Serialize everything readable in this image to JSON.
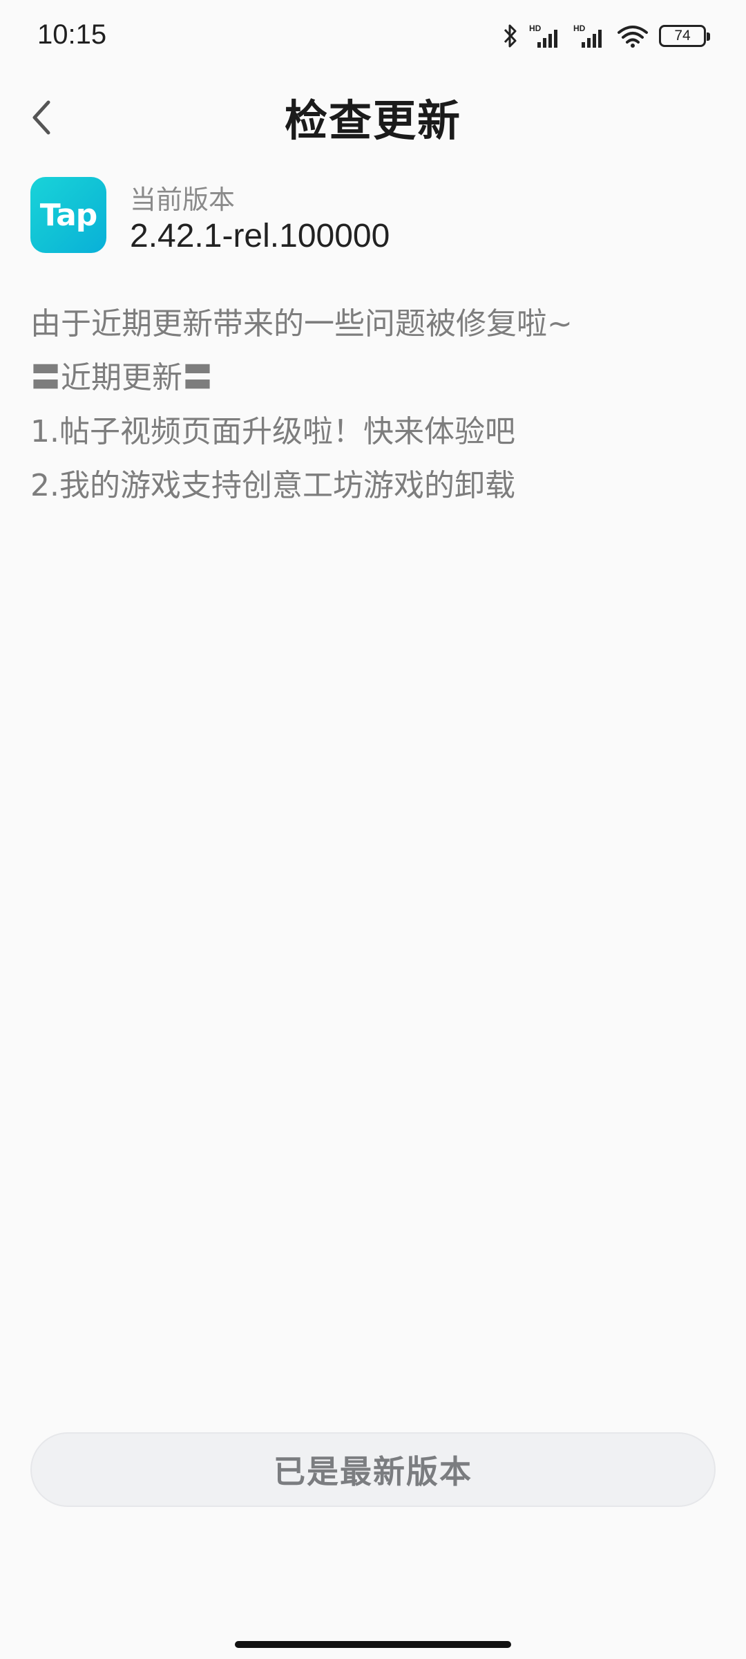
{
  "status_bar": {
    "time": "10:15",
    "battery": "74",
    "icons": [
      "bluetooth-icon",
      "signal-hd-icon",
      "signal-hd-icon",
      "wifi-icon",
      "battery-icon"
    ]
  },
  "header": {
    "title": "检查更新",
    "back_icon": "chevron-left-icon"
  },
  "version_info": {
    "logo_text": "Tap",
    "label": "当前版本",
    "value": "2.42.1-rel.100000",
    "logo_color": "#13c3d8"
  },
  "release_notes": [
    "由于近期更新带来的一些问题被修复啦~",
    "〓近期更新〓",
    "1.帖子视频页面升级啦！快来体验吧",
    "2.我的游戏支持创意工坊游戏的卸载"
  ],
  "action": {
    "label": "已是最新版本"
  }
}
